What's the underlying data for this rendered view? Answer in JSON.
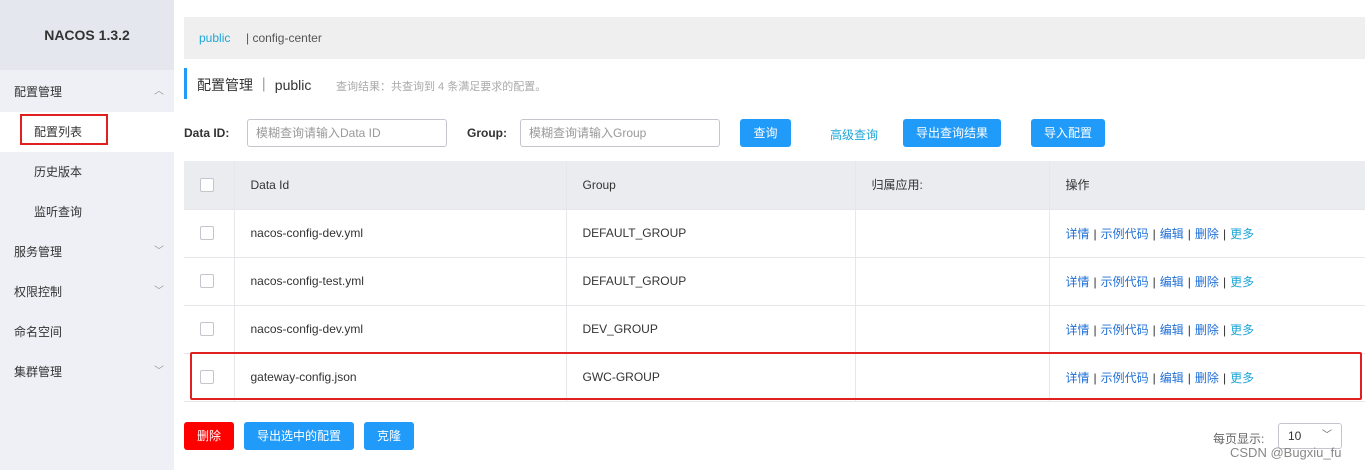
{
  "brand": "NACOS 1.3.2",
  "sidebar": {
    "items": [
      {
        "label": "配置管理",
        "chevron": "︿"
      },
      {
        "label": "配置列表"
      },
      {
        "label": "历史版本"
      },
      {
        "label": "监听查询"
      },
      {
        "label": "服务管理",
        "chevron": "﹀"
      },
      {
        "label": "权限控制",
        "chevron": "﹀"
      },
      {
        "label": "命名空间"
      },
      {
        "label": "集群管理",
        "chevron": "﹀"
      }
    ]
  },
  "breadcrumb": {
    "namespace": "public",
    "current": "| config-center"
  },
  "header": {
    "title": "配置管理 ｜ public",
    "result": "查询结果：共查询到 4 条满足要求的配置。"
  },
  "search": {
    "data_id_label": "Data ID:",
    "data_id_placeholder": "模糊查询请输入Data ID",
    "group_label": "Group:",
    "group_placeholder": "模糊查询请输入Group",
    "query_button": "查询",
    "advanced_link": "高级查询",
    "export_button": "导出查询结果",
    "import_button": "导入配置"
  },
  "table": {
    "headers": [
      "Data Id",
      "Group",
      "归属应用:",
      "操作"
    ],
    "rows": [
      {
        "data_id": "nacos-config-dev.yml",
        "group": "DEFAULT_GROUP",
        "app": ""
      },
      {
        "data_id": "nacos-config-test.yml",
        "group": "DEFAULT_GROUP",
        "app": ""
      },
      {
        "data_id": "nacos-config-dev.yml",
        "group": "DEV_GROUP",
        "app": ""
      },
      {
        "data_id": "gateway-config.json",
        "group": "GWC-GROUP",
        "app": ""
      }
    ],
    "ops": {
      "detail": "详情",
      "sample": "示例代码",
      "edit": "编辑",
      "delete": "删除",
      "more": "更多",
      "separator": "|"
    }
  },
  "footer": {
    "delete_button": "删除",
    "export_selected_button": "导出选中的配置",
    "clone_button": "克隆",
    "page_size_label": "每页显示:",
    "page_size_value": "10",
    "chevron": "﹀"
  },
  "watermark": "CSDN @Bugxiu_fu",
  "colors": {
    "accent": "#209bfa",
    "link": "#1fa6d8",
    "danger": "#ff0000",
    "highlight_box": "#e02020"
  }
}
